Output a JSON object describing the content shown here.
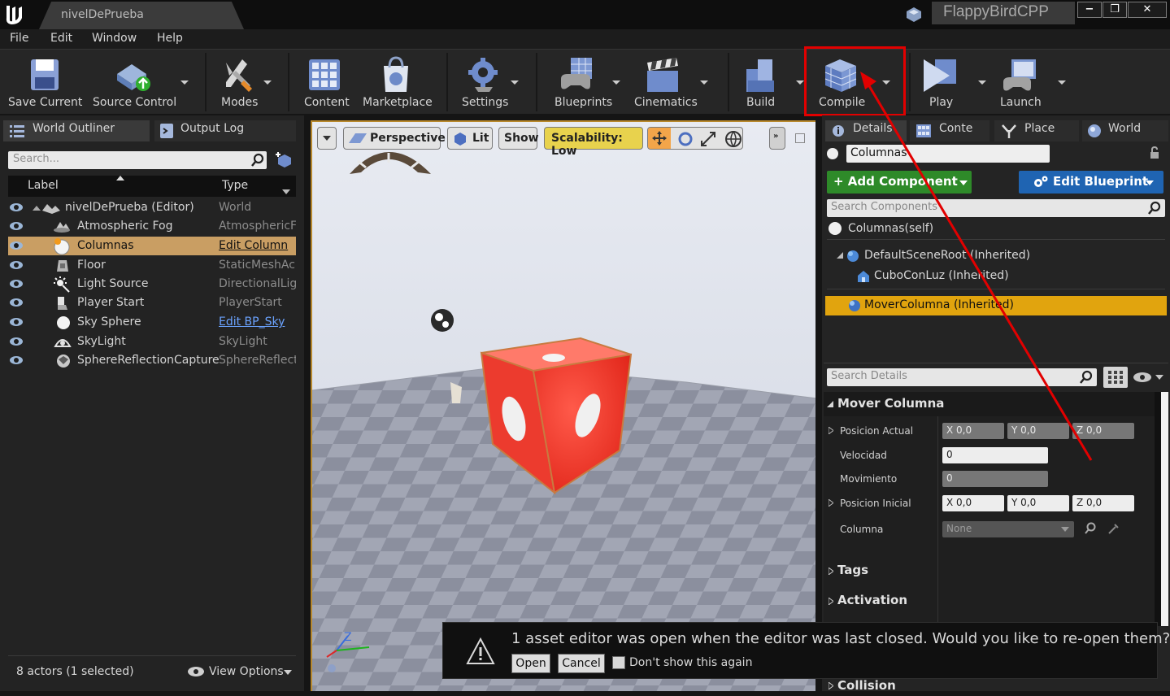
{
  "window": {
    "tab_title": "nivelDePrueba",
    "project_name": "FlappyBirdCPP",
    "minimize": "−",
    "maximize": "❐",
    "close": "✕"
  },
  "menu": [
    "File",
    "Edit",
    "Window",
    "Help"
  ],
  "toolbar": {
    "save_current": "Save Current",
    "source_control": "Source Control",
    "modes": "Modes",
    "content": "Content",
    "marketplace": "Marketplace",
    "settings": "Settings",
    "blueprints": "Blueprints",
    "cinematics": "Cinematics",
    "build": "Build",
    "compile": "Compile",
    "play": "Play",
    "launch": "Launch"
  },
  "outliner": {
    "tab": "World Outliner",
    "tab2": "Output Log",
    "search_placeholder": "Search...",
    "col_label": "Label",
    "col_type": "Type",
    "rows": [
      {
        "label": "nivelDePrueba (Editor)",
        "type": "World"
      },
      {
        "label": "Atmospheric Fog",
        "type": "AtmosphericF"
      },
      {
        "label": "Columnas",
        "type": "Edit Column"
      },
      {
        "label": "Floor",
        "type": "StaticMeshAc"
      },
      {
        "label": "Light Source",
        "type": "DirectionalLig"
      },
      {
        "label": "Player Start",
        "type": "PlayerStart"
      },
      {
        "label": "Sky Sphere",
        "type": "Edit BP_Sky"
      },
      {
        "label": "SkyLight",
        "type": "SkyLight"
      },
      {
        "label": "SphereReflectionCapture",
        "type": "SphereReflect"
      }
    ],
    "actor_count": "8 actors (1 selected)",
    "view_options": "View Options"
  },
  "viewport": {
    "perspective": "Perspective",
    "lit": "Lit",
    "show": "Show",
    "scalability": "Scalability: Low",
    "axis_z": "Z"
  },
  "details": {
    "tabs": [
      "Details",
      "Conte",
      "Place",
      "World"
    ],
    "actor_name": "Columnas",
    "add_component": "+ Add Component",
    "edit_blueprint": "Edit Blueprint",
    "search_components": "Search Components",
    "self": "Columnas(self)",
    "components": [
      "DefaultSceneRoot (Inherited)",
      "CuboConLuz (Inherited)",
      "MoverColumna (Inherited)"
    ],
    "search_details": "Search Details",
    "section_title": "Mover Columna",
    "posicion_actual": "Posicion Actual",
    "pa_x": "X 0,0",
    "pa_y": "Y 0,0",
    "pa_z": "Z 0,0",
    "velocidad": "Velocidad",
    "velocidad_val": "0",
    "movimiento": "Movimiento",
    "movimiento_val": "0",
    "posicion_inicial": "Posicion Inicial",
    "pi_x": "X 0,0",
    "pi_y": "Y 0,0",
    "pi_z": "Z 0,0",
    "columna": "Columna",
    "columna_val": "None",
    "tags": "Tags",
    "activation": "Activation",
    "collision": "Collision"
  },
  "notification": {
    "message": "1 asset editor was open when the editor was last closed. Would you like to re-open them?",
    "open": "Open",
    "cancel": "Cancel",
    "dont_show": "Don't show this again"
  },
  "colors": {
    "highlight": "#e20000",
    "selection": "#c99e63",
    "component_selected": "#e1a40e",
    "add_component": "#2e8a29",
    "edit_blueprint": "#1f64b2"
  }
}
